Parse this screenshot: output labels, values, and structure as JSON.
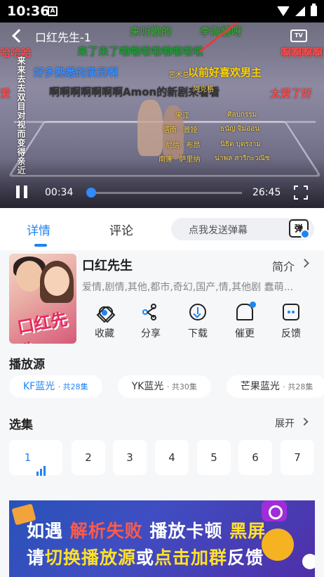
{
  "status_bar": {
    "time": "10:36",
    "notif_letter": "A"
  },
  "player": {
    "title": "口红先生-1",
    "tv_label": "TV",
    "current_time": "00:34",
    "duration": "26:45",
    "progress": 0.0212,
    "danmaku": [
      {
        "text": "来听歌的",
        "color": "#3a9a3a"
      },
      {
        "text": "李海娜呀",
        "color": "#3a9a3a"
      },
      {
        "text": "哈哈哈",
        "color": "#ff4b4b"
      },
      {
        "text": "来了来了啦啦啦啦啦啦啦啦",
        "color": "#1e9a34"
      },
      {
        "text": "啊啊啊啊啊",
        "color": "#ff4b4b"
      },
      {
        "text": "好多熟悉的演员啊",
        "color": "#3a8cff"
      },
      {
        "text": "以前好喜欢男主",
        "color": "#ffd400"
      },
      {
        "text": "爱",
        "color": "#ff4b4b"
      },
      {
        "text": "啊啊啊啊啊啊啊Amon的新剧来看看",
        "color": "#333333"
      },
      {
        "text": "太爱了好",
        "color": "#ff4b4b"
      }
    ],
    "vertical_text": "来来去去双目对视而变得亲近",
    "subtitles": [
      {
        "text": "艺术总"
      },
      {
        "text": "宋江"
      },
      {
        "text": "塔南 · 普娅"
      },
      {
        "text": "尼信 · 布昂"
      },
      {
        "text": "阿克格"
      },
      {
        "text": "南蓬 · 萨里纳"
      },
      {
        "text": "ศิลปกรรม"
      },
      {
        "text": "ธนัญ จิ่มอ่อน"
      },
      {
        "text": "นิธิต บุตรงาม"
      },
      {
        "text": "น่าพล สาริกะวณิช"
      }
    ]
  },
  "tabs": [
    {
      "label": "详情",
      "active": true
    },
    {
      "label": "评论",
      "active": false
    }
  ],
  "danmu_input": {
    "placeholder": "点我发送弹幕",
    "toggle_label": "弹"
  },
  "show": {
    "title": "口红先生",
    "intro_label": "简介",
    "genres": "爱情,剧情,其他,都市,奇幻,国产,情,其他剧 蠢萌...",
    "poster_logo": "口红先生",
    "actions": [
      {
        "label": "收藏",
        "icon": "heart-icon"
      },
      {
        "label": "分享",
        "icon": "share-icon"
      },
      {
        "label": "下载",
        "icon": "download-icon"
      },
      {
        "label": "催更",
        "icon": "bell-icon"
      },
      {
        "label": "反馈",
        "icon": "feedback-icon"
      }
    ]
  },
  "sources_section": {
    "title": "播放源",
    "items": [
      {
        "name": "KF蓝光",
        "count": "· 共28集",
        "active": true
      },
      {
        "name": "YK蓝光",
        "count": "· 共30集",
        "active": false
      },
      {
        "name": "芒果蓝光",
        "count": "· 共28集",
        "active": false
      }
    ]
  },
  "episodes_section": {
    "title": "选集",
    "expand_label": "展开",
    "episodes": [
      "1",
      "2",
      "3",
      "4",
      "5",
      "6",
      "7"
    ],
    "current": "1"
  },
  "banner": {
    "line1_a": "如遇",
    "line1_b": "解析失败",
    "line1_c": "播放卡顿",
    "line1_d": "黑屏",
    "line2_a": "请",
    "line2_b": "切换播放源",
    "line2_c": "或",
    "line2_d": "点击加群",
    "line2_e": "反馈"
  },
  "colors": {
    "accent": "#1f84f2",
    "arrow": "#e53b3b",
    "banner_highlight": "#ffe02b"
  }
}
